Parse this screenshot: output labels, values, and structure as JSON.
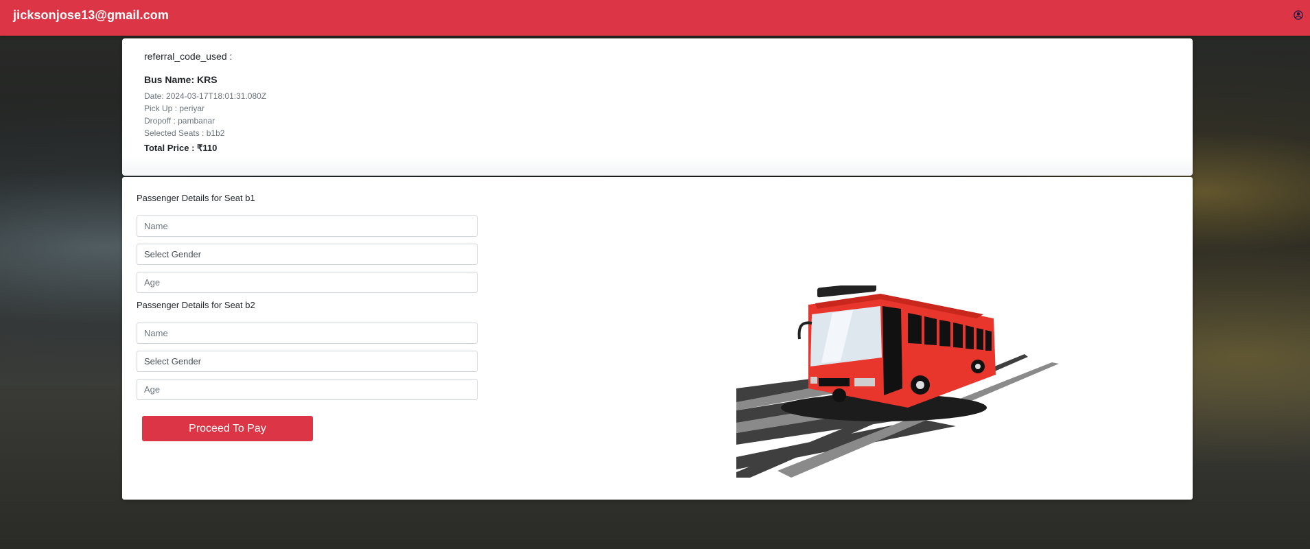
{
  "header": {
    "user_email": "jicksonjose13@gmail.com",
    "profile_icon": "user-circle-icon"
  },
  "booking": {
    "referral_label": "referral_code_used :",
    "bus_name": "Bus Name: KRS",
    "date": "Date: 2024-03-17T18:01:31.080Z",
    "pickup": "Pick Up : periyar",
    "dropoff": "Dropoff : pambanar",
    "seats": "Selected Seats : b1b2",
    "total_price": "Total Price : ₹110"
  },
  "passengers": [
    {
      "title": "Passenger Details for Seat b1",
      "name_placeholder": "Name",
      "gender_placeholder": "Select Gender",
      "age_placeholder": "Age"
    },
    {
      "title": "Passenger Details for Seat b2",
      "name_placeholder": "Name",
      "gender_placeholder": "Select Gender",
      "age_placeholder": "Age"
    }
  ],
  "actions": {
    "proceed_label": "Proceed To Pay"
  },
  "colors": {
    "brand": "#dc3545",
    "bus_red": "#e8362c"
  }
}
